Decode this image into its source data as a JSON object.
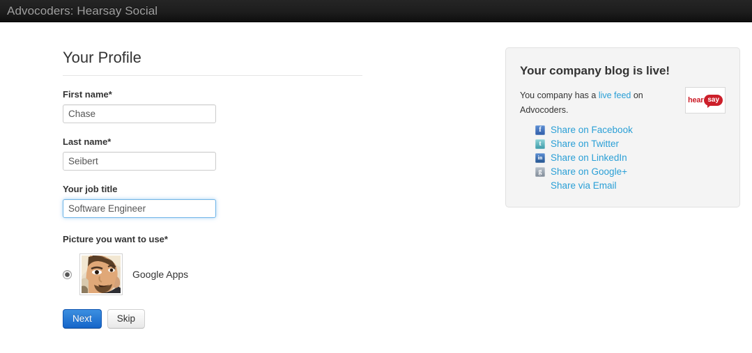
{
  "navbar": {
    "brand": "Advocoders: Hearsay Social"
  },
  "profile": {
    "title": "Your Profile",
    "fields": [
      {
        "label": "First name*",
        "value": "Chase",
        "focused": false
      },
      {
        "label": "Last name*",
        "value": "Seibert",
        "focused": false
      },
      {
        "label": "Your job title",
        "value": "Software Engineer",
        "focused": true
      }
    ],
    "picture": {
      "label": "Picture you want to use*",
      "option_label": "Google Apps",
      "selected": true
    },
    "buttons": {
      "next": "Next",
      "skip": "Skip"
    }
  },
  "blog_panel": {
    "title": "Your company blog is live!",
    "text_before": "You company has a ",
    "link_text": "live feed",
    "text_after": " on Advocoders.",
    "logo": {
      "part1": "hear",
      "part2": "say"
    },
    "share_links": [
      {
        "label": "Share on Facebook",
        "icon": "facebook-icon",
        "glyph": "f",
        "cls": "facebook"
      },
      {
        "label": "Share on Twitter",
        "icon": "twitter-icon",
        "glyph": "t",
        "cls": "twitter"
      },
      {
        "label": "Share on LinkedIn",
        "icon": "linkedin-icon",
        "glyph": "in",
        "cls": "linkedin"
      },
      {
        "label": "Share on Google+",
        "icon": "googleplus-icon",
        "glyph": "g",
        "cls": "googleplus"
      },
      {
        "label": "Share via Email",
        "icon": "no-icon",
        "glyph": "",
        "cls": "blank"
      }
    ]
  },
  "colors": {
    "link": "#2a9fd6",
    "primary_button": "#1565c9",
    "navbar_bg": "#1d1d1d",
    "panel_bg": "#f4f4f4",
    "brand_red": "#cc1f2a"
  }
}
